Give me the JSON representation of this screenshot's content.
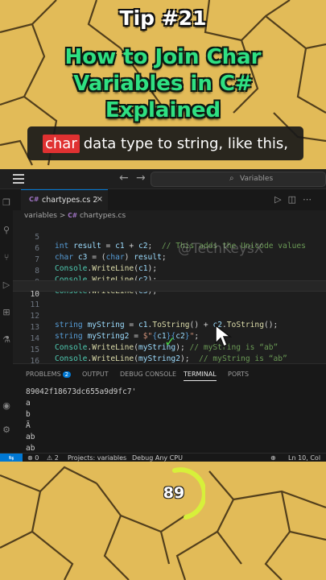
{
  "overlay": {
    "tip_number": "Tip #21",
    "headline_lines": [
      "How to Join Char",
      "Variables in C#",
      "Explained"
    ],
    "caption_highlight": "char",
    "caption_text": "data type to string, like this,",
    "timer_value": "89"
  },
  "titlebar": {
    "back": "←",
    "forward": "→",
    "command_center": "Variables"
  },
  "tab": {
    "file_icon": "C#",
    "label": "chartypes.cs 2",
    "close": "×"
  },
  "breadcrumb": {
    "folder": "variables",
    "separator": ">",
    "file_icon": "C#",
    "file": "chartypes.cs"
  },
  "watermark": "@TechKeysX",
  "code_lines": [
    {
      "n": "5",
      "text": "int result = c1 + c2;  // This adds the Unicode values"
    },
    {
      "n": "6",
      "text": "char c3 = (char) result;"
    },
    {
      "n": "7",
      "text": "Console.WriteLine(c1);"
    },
    {
      "n": "8",
      "text": "Console.WriteLine(c2);"
    },
    {
      "n": "9",
      "text": "Console.WriteLine(c3);"
    },
    {
      "n": "10",
      "text": ""
    },
    {
      "n": "11",
      "text": ""
    },
    {
      "n": "12",
      "text": "string myString = c1.ToString() + c2.ToString();"
    },
    {
      "n": "13",
      "text": "string myString2 = $\"{c1}{c2}\";"
    },
    {
      "n": "14",
      "text": "Console.WriteLine(myString); // myString is “ab”"
    },
    {
      "n": "15",
      "text": "Console.WriteLine(myString2);  // myString is “ab”"
    },
    {
      "n": "16",
      "text": ""
    }
  ],
  "panel": {
    "tabs": [
      "PROBLEMS",
      "OUTPUT",
      "DEBUG CONSOLE",
      "TERMINAL",
      "PORTS"
    ],
    "problems_count": "2",
    "active_tab": "TERMINAL",
    "terminal_lines": [
      "89042f18673dc655a9d9fc7'",
      "a",
      "b",
      "Ã",
      "ab",
      "ab"
    ]
  },
  "statusbar": {
    "remote": "⇆",
    "errors": "⊗ 0",
    "warnings": "⚠ 2",
    "project": "Projects: variables",
    "debug": "Debug Any CPU",
    "cursor": "Ln 10, Col 1"
  },
  "colors": {
    "accent": "#0078d4",
    "headline": "#2fe082",
    "caption_highlight": "#e03131",
    "editor_bg": "#1e1e1e",
    "background": "#e2bb58"
  }
}
